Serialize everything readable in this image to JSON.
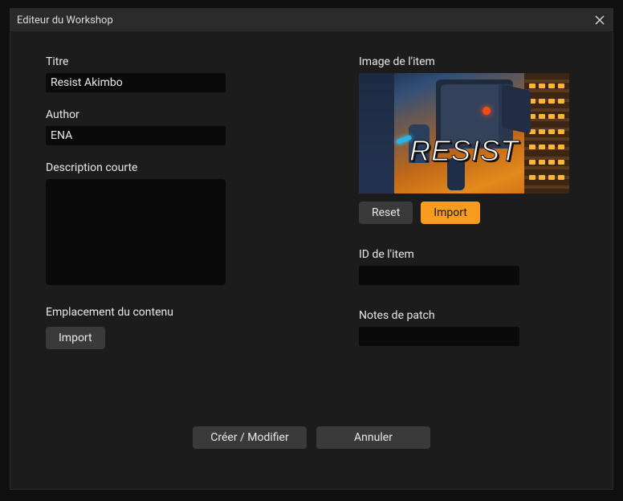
{
  "window": {
    "title": "Editeur du Workshop"
  },
  "left": {
    "titre_label": "Titre",
    "titre_value": "Resist Akimbo",
    "author_label": "Author",
    "author_value": "ENA",
    "desc_label": "Description courte",
    "desc_value": "",
    "content_loc_label": "Emplacement du contenu",
    "import_label": "Import"
  },
  "right": {
    "image_label": "Image de l'item",
    "logo_text": "RESIST",
    "reset_label": "Reset",
    "import_label": "Import",
    "id_label": "ID de l'item",
    "id_value": "",
    "patch_label": "Notes de patch",
    "patch_value": ""
  },
  "footer": {
    "create_label": "Créer / Modifier",
    "cancel_label": "Annuler"
  }
}
